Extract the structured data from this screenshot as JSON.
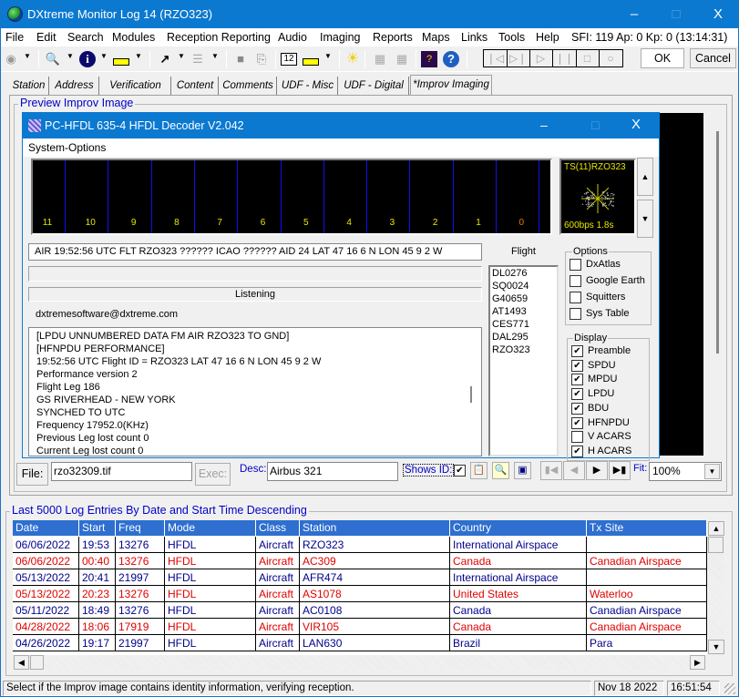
{
  "window": {
    "title": "DXtreme Monitor Log 14 (RZO323)",
    "minimize": "–",
    "maximize": "□",
    "close": "X"
  },
  "menubar": {
    "items": [
      "File",
      "Edit",
      "Search",
      "Modules",
      "Reception Reporting",
      "Audio",
      "Imaging",
      "Reports",
      "Maps",
      "Links",
      "Tools",
      "Help"
    ],
    "solar": "SFI: 119 Ap: 0 Kp: 0 (13:14:31)"
  },
  "toolbar": {
    "icons": [
      "binoculars-icon",
      "search-document-icon",
      "info-icon",
      "radio-icon",
      "cursor-icon",
      "list-icon",
      "stop-record-icon",
      "print-icon",
      "calendar-icon",
      "radio-signal-icon",
      "sun-icon",
      "grid-icon",
      "grid2-icon",
      "book-icon",
      "help-icon"
    ],
    "ok": "OK",
    "cancel": "Cancel",
    "media": [
      "❘◁",
      "▷❘",
      "▷",
      "❘❘",
      "□",
      "○"
    ]
  },
  "tabs": [
    {
      "label": "Station",
      "active": false
    },
    {
      "label": "Address",
      "active": false
    },
    {
      "label": "Verification",
      "active": false
    },
    {
      "label": "Content",
      "active": false
    },
    {
      "label": "Comments",
      "active": false
    },
    {
      "label": "UDF - Misc",
      "active": false
    },
    {
      "label": "UDF - Digital",
      "active": false
    },
    {
      "label": "*Improv Imaging",
      "active": true
    }
  ],
  "preview": {
    "group_label": "Preview Improv Image",
    "decoder": {
      "title": "PC-HFDL 635-4 HFDL Decoder V2.042",
      "menu": "System-Options",
      "slots": [
        "11",
        "10",
        "9",
        "8",
        "7",
        "6",
        "5",
        "4",
        "3",
        "2",
        "1",
        "0"
      ],
      "constellation_top": "TS(11)RZO323",
      "constellation_bottom": "600bps 1.8s",
      "air_line": "AIR 19:52:56  UTC FLT RZO323 ?????? ICAO ?????? AID 24 LAT 47 16 6  N  LON 45 9 2  W",
      "status": "Listening",
      "email": "dxtremesoftware@dxtreme.com",
      "decoded_lines": [
        "[LPDU UNNUMBERED DATA FM AIR RZO323 TO GND]",
        "[HFNPDU PERFORMANCE]",
        "19:52:56  UTC  Flight ID = RZO323  LAT 47 16 6  N  LON 45 9 2  W",
        "Performance version 2",
        "Flight Leg 186",
        "GS RIVERHEAD - NEW YORK",
        "SYNCHED TO UTC",
        "Frequency  17952.0(KHz)",
        "Previous Leg lost count 0",
        "Current Leg lost count 0"
      ],
      "flight_label": "Flight",
      "flights": [
        "DL0276",
        "SQ0024",
        "G40659",
        "AT1493",
        "CES771",
        "DAL295",
        "RZO323"
      ],
      "options_label": "Options",
      "options": [
        {
          "label": "DxAtlas",
          "checked": false
        },
        {
          "label": "Google Earth",
          "checked": false
        },
        {
          "label": "Squitters",
          "checked": false
        },
        {
          "label": "Sys Table",
          "checked": false
        }
      ],
      "display_label": "Display",
      "display": [
        {
          "label": "Preamble",
          "checked": true
        },
        {
          "label": "SPDU",
          "checked": true
        },
        {
          "label": "MPDU",
          "checked": true
        },
        {
          "label": "LPDU",
          "checked": true
        },
        {
          "label": "BDU",
          "checked": true
        },
        {
          "label": "HFNPDU",
          "checked": true
        },
        {
          "label": "V ACARS",
          "checked": false
        },
        {
          "label": "H ACARS",
          "checked": true
        }
      ]
    }
  },
  "imagebar": {
    "file_button": "File:",
    "file_value": "rzo32309.tif",
    "exec_button": "Exec:",
    "desc_label": "Desc:",
    "desc_value": "Airbus 321",
    "shows_id_label": "Shows ID:",
    "shows_id_checked": true,
    "fit_label": "Fit:",
    "fit_value": "100%"
  },
  "log": {
    "group_label": "Last 5000 Log Entries By Date and Start Time Descending",
    "columns": [
      "Date",
      "Start",
      "Freq",
      "Mode",
      "Class",
      "Station",
      "Country",
      "Tx Site"
    ],
    "rows": [
      {
        "cells": [
          "06/06/2022",
          "19:53",
          "13276",
          "HFDL",
          "Aircraft",
          "RZO323",
          "International Airspace",
          ""
        ],
        "color": "#00008b"
      },
      {
        "cells": [
          "06/06/2022",
          "00:40",
          "13276",
          "HFDL",
          "Aircraft",
          "AC309",
          "Canada",
          "Canadian Airspace"
        ],
        "color": "#e00000"
      },
      {
        "cells": [
          "05/13/2022",
          "20:41",
          "21997",
          "HFDL",
          "Aircraft",
          "AFR474",
          "International Airspace",
          ""
        ],
        "color": "#00008b"
      },
      {
        "cells": [
          "05/13/2022",
          "20:23",
          "13276",
          "HFDL",
          "Aircraft",
          "AS1078",
          "United States",
          "Waterloo"
        ],
        "color": "#e00000"
      },
      {
        "cells": [
          "05/11/2022",
          "18:49",
          "13276",
          "HFDL",
          "Aircraft",
          "AC0108",
          "Canada",
          "Canadian Airspace"
        ],
        "color": "#00008b"
      },
      {
        "cells": [
          "04/28/2022",
          "18:06",
          "17919",
          "HFDL",
          "Aircraft",
          "VIR105",
          "Canada",
          "Canadian Airspace"
        ],
        "color": "#e00000"
      },
      {
        "cells": [
          "04/26/2022",
          "19:17",
          "21997",
          "HFDL",
          "Aircraft",
          "LAN630",
          "Brazil",
          "Para"
        ],
        "color": "#00008b"
      }
    ]
  },
  "statusbar": {
    "message": "Select if the Improv image contains identity information, verifying reception.",
    "date": "Nov 18 2022",
    "time": "16:51:54"
  }
}
